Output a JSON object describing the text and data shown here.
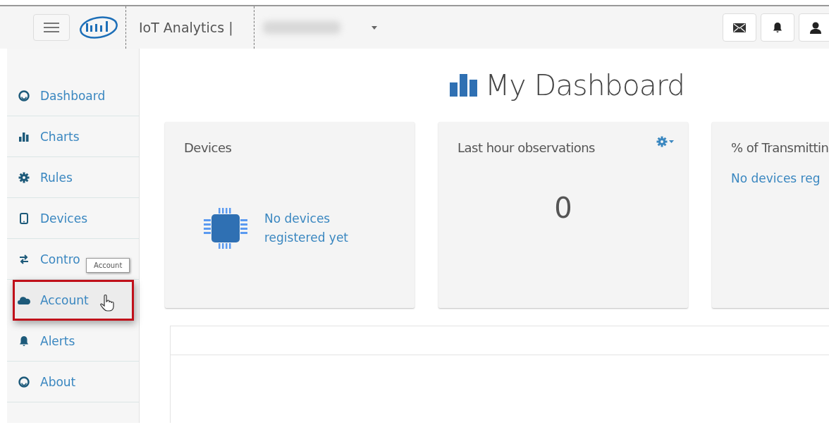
{
  "header": {
    "app_title": "IoT Analytics |"
  },
  "sidebar": {
    "items": [
      {
        "label": "Dashboard",
        "highlighted": false
      },
      {
        "label": "Charts",
        "highlighted": false
      },
      {
        "label": "Rules",
        "highlighted": false
      },
      {
        "label": "Devices",
        "highlighted": false
      },
      {
        "label": "Contro",
        "highlighted": false
      },
      {
        "label": "Account",
        "highlighted": true
      },
      {
        "label": "Alerts",
        "highlighted": false
      },
      {
        "label": "About",
        "highlighted": false
      }
    ],
    "tooltip": "Account"
  },
  "page_title": "My Dashboard",
  "cards": [
    {
      "kind": "devices",
      "title": "Devices",
      "message": "No devices registered yet"
    },
    {
      "kind": "count",
      "title": "Last hour observations",
      "value": "0",
      "settings": true
    },
    {
      "kind": "percent",
      "title": "% of Transmittin",
      "message": "No devices reg"
    }
  ]
}
